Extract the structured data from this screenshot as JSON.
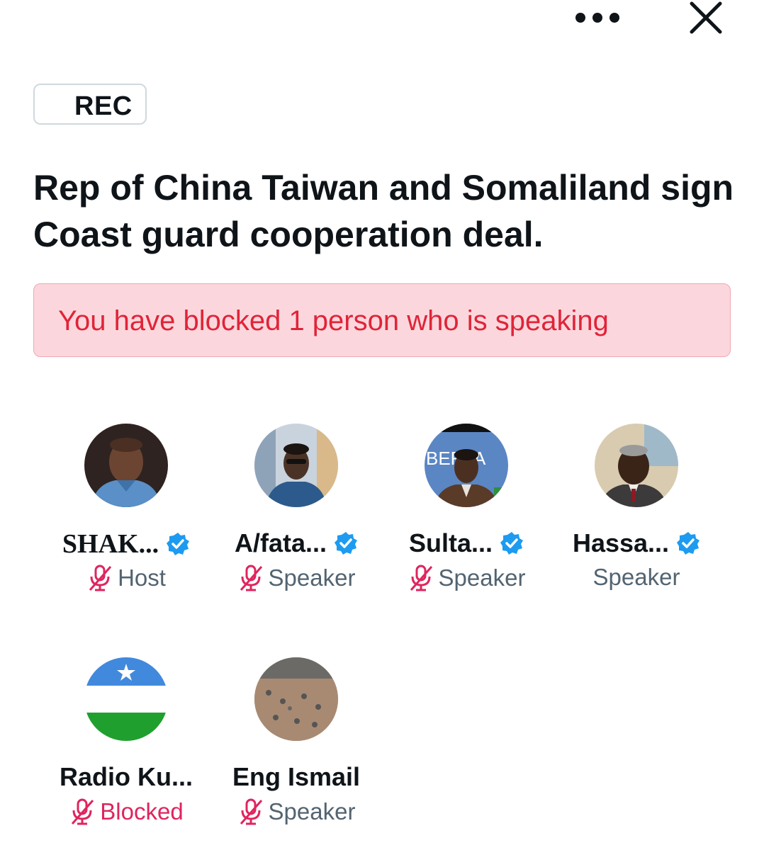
{
  "header": {
    "more_icon": "more-horizontal-icon",
    "close_icon": "close-icon"
  },
  "rec_label": "REC",
  "space_title": "Rep of China Taiwan and Somaliland sign Coast guard cooperation deal.",
  "alert": {
    "text": "You have blocked 1 person who is speaking"
  },
  "participants": [
    {
      "name": "SHAK...",
      "role": "Host",
      "verified": true,
      "muted": true
    },
    {
      "name": "A/fata...",
      "role": "Speaker",
      "verified": true,
      "muted": true
    },
    {
      "name": "Sulta...",
      "role": "Speaker",
      "verified": true,
      "muted": true,
      "avatar_text": "BERTA"
    },
    {
      "name": "Hassa...",
      "role": "Speaker",
      "verified": true,
      "muted": false
    },
    {
      "name": "Radio Ku...",
      "role": "Blocked",
      "verified": false,
      "muted": true
    },
    {
      "name": "Eng Ismail",
      "role": "Speaker",
      "verified": false,
      "muted": true
    }
  ],
  "colors": {
    "verified": "#1d9bf0",
    "muted_mic": "#e0245e",
    "alert_bg": "#fbd7dd",
    "alert_text": "#e02438"
  }
}
